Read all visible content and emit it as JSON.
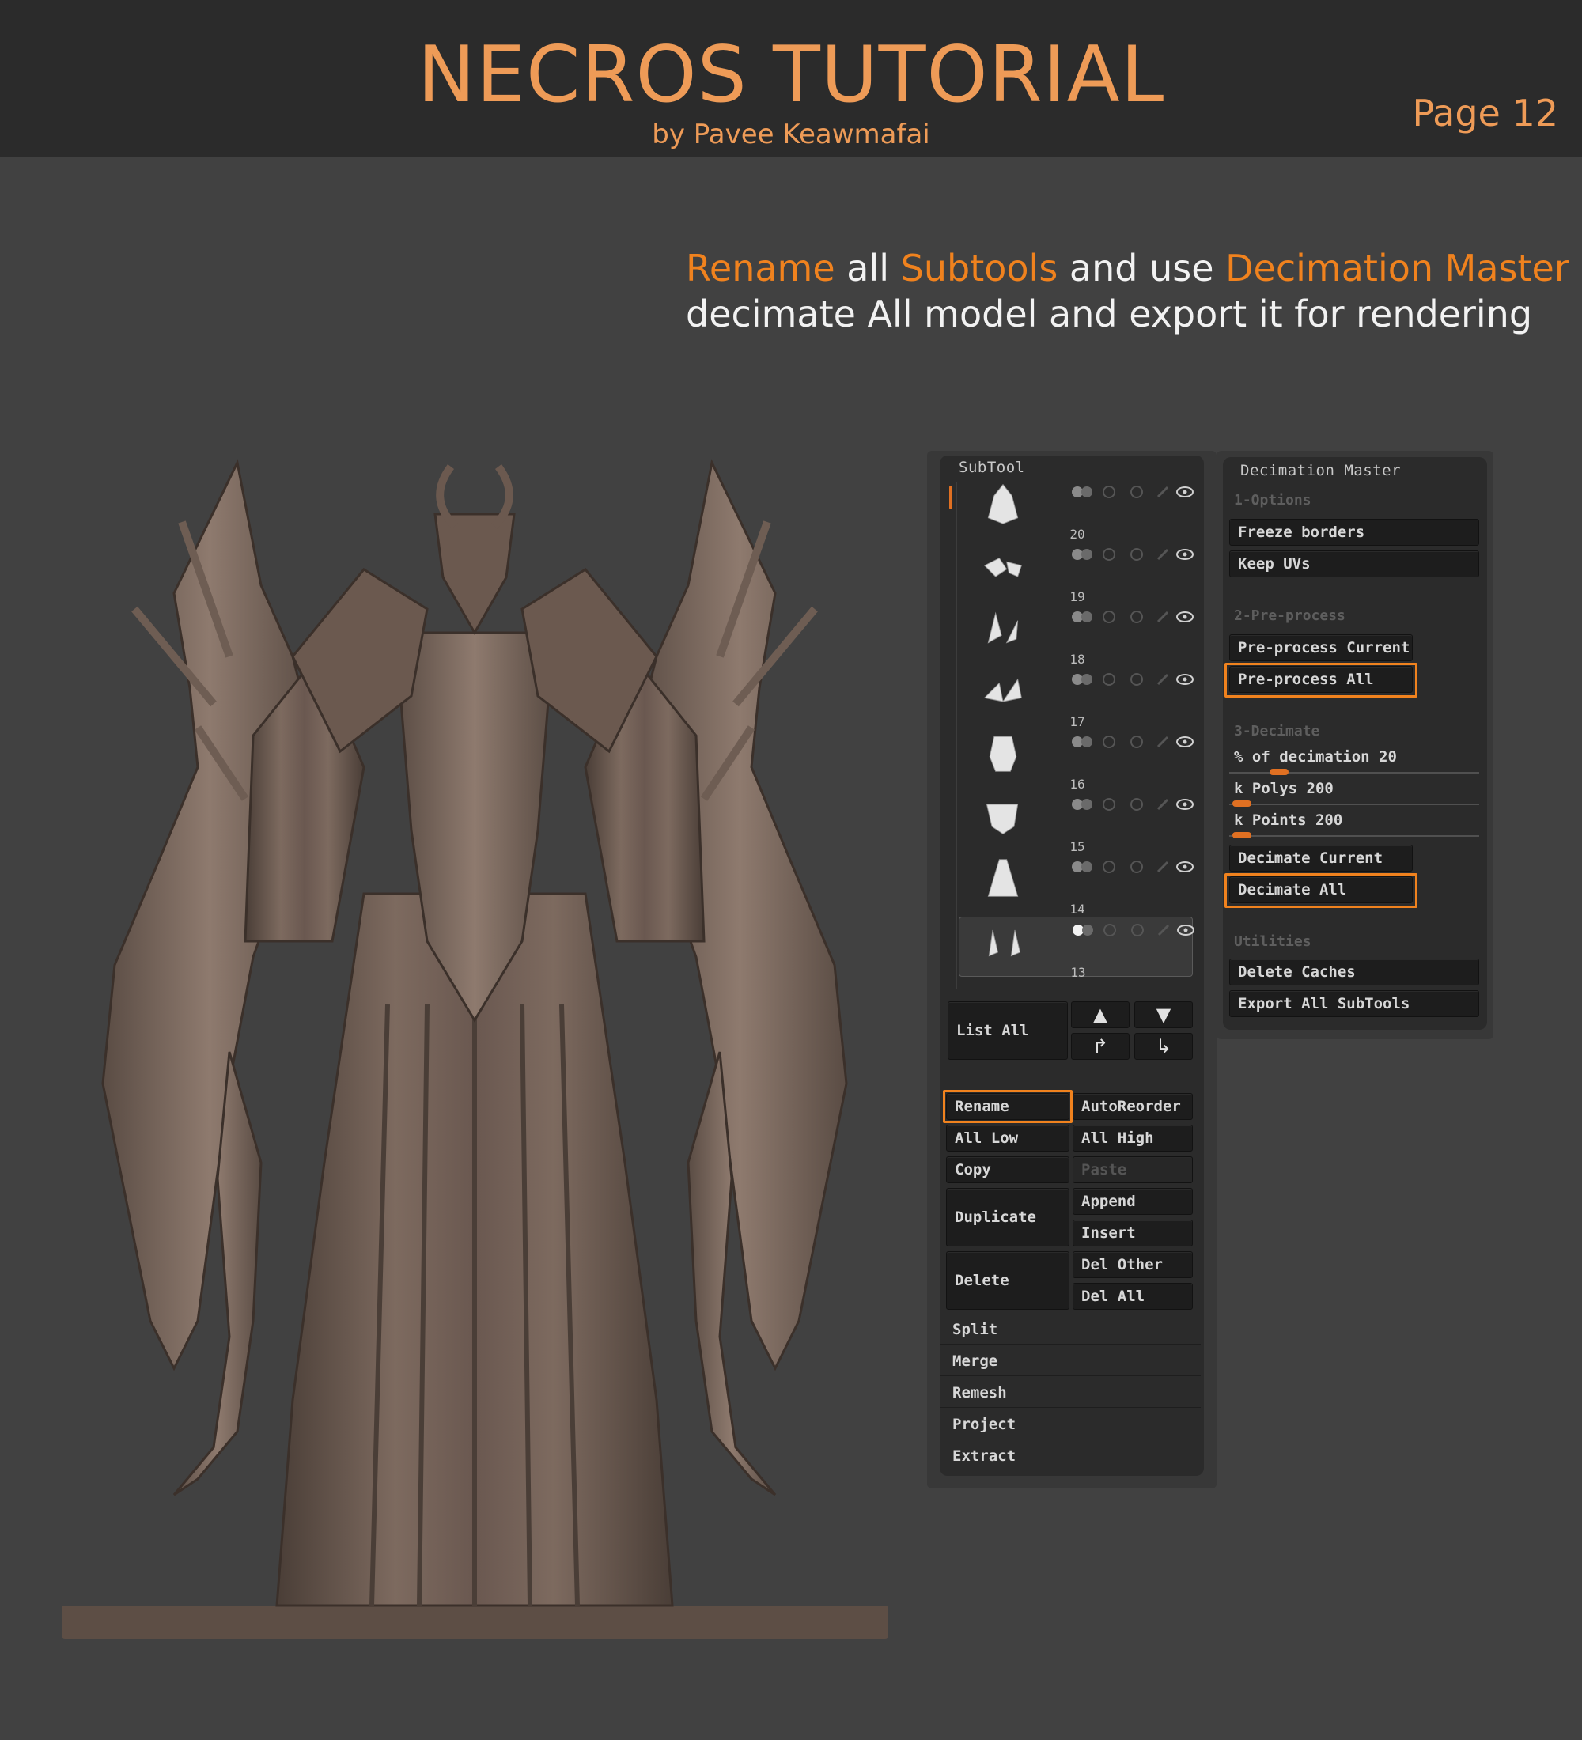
{
  "header": {
    "title": "NECROS TUTORIAL",
    "byline": "by Pavee Keawmafai",
    "page": "Page 12"
  },
  "instructions": {
    "line1_part1": "Rename",
    "line1_part2": " all ",
    "line1_part3": "Subtools",
    "line1_part4": " and use ",
    "line1_part5": "Decimation Master",
    "line2": "decimate All model and export it for rendering",
    "highlight_color": "#f0821e"
  },
  "subtool_panel": {
    "title": "SubTool",
    "rows": [
      {
        "num": "20",
        "icon": "subtool-head-thumbnail"
      },
      {
        "num": "19",
        "icon": "subtool-pieces-thumbnail"
      },
      {
        "num": "18",
        "icon": "subtool-claws-thumbnail"
      },
      {
        "num": "17",
        "icon": "subtool-wings-thumbnail"
      },
      {
        "num": "16",
        "icon": "subtool-torso-thumbnail"
      },
      {
        "num": "15",
        "icon": "subtool-collar-thumbnail"
      },
      {
        "num": "14",
        "icon": "subtool-robe-thumbnail"
      },
      {
        "num": "13",
        "icon": "subtool-horns-thumbnail"
      }
    ],
    "list_all": "List All",
    "rename": "Rename",
    "autoreorder": "AutoReorder",
    "all_low": "All Low",
    "all_high": "All High",
    "copy": "Copy",
    "paste": "Paste",
    "duplicate": "Duplicate",
    "append": "Append",
    "insert": "Insert",
    "delete": "Delete",
    "del_other": "Del Other",
    "del_all": "Del All",
    "split": "Split",
    "merge": "Merge",
    "remesh": "Remesh",
    "project": "Project",
    "extract": "Extract"
  },
  "decimation_panel": {
    "title": "Decimation Master",
    "section1": "1-Options",
    "freeze_borders": "Freeze borders",
    "keep_uvs": "Keep UVs",
    "section2": "2-Pre-process",
    "preprocess_current": "Pre-process Current",
    "preprocess_all": "Pre-process All",
    "section3": "3-Decimate",
    "pct_label": "% of decimation 20",
    "pct_value": 0.2,
    "kpolys_label": "k Polys 200",
    "kpolys_value": 0.05,
    "kpoints_label": "k Points 200",
    "kpoints_value": 0.05,
    "decimate_current": "Decimate Current",
    "decimate_all": "Decimate All",
    "section4": "Utilities",
    "delete_caches": "Delete Caches",
    "export_all": "Export All SubTools"
  }
}
